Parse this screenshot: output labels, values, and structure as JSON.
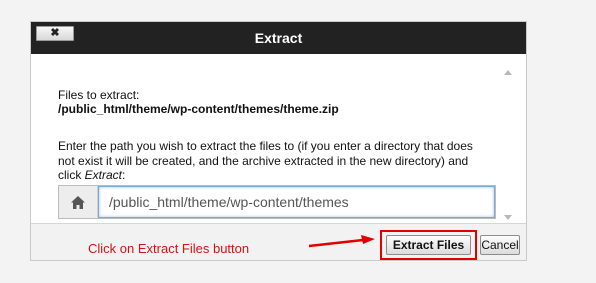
{
  "dialog": {
    "title": "Extract",
    "close_label": "✖",
    "files_label": "Files to extract:",
    "file_path": "/public_html/theme/wp-content/themes/theme.zip",
    "instructions_prefix": "Enter the path you wish to extract the files to (if you enter a directory that does not exist it will be created, and the archive extracted in the new directory) and click ",
    "instructions_action": "Extract",
    "instructions_suffix": ":",
    "path_value": "/public_html/theme/wp-content/themes",
    "home_icon": "home-icon"
  },
  "footer": {
    "hint": "Click on Extract Files button",
    "extract_label": "Extract Files",
    "cancel_label": "Cancel"
  },
  "colors": {
    "titlebar": "#222222",
    "highlight": "#e00000",
    "hint_text": "#d21414"
  }
}
